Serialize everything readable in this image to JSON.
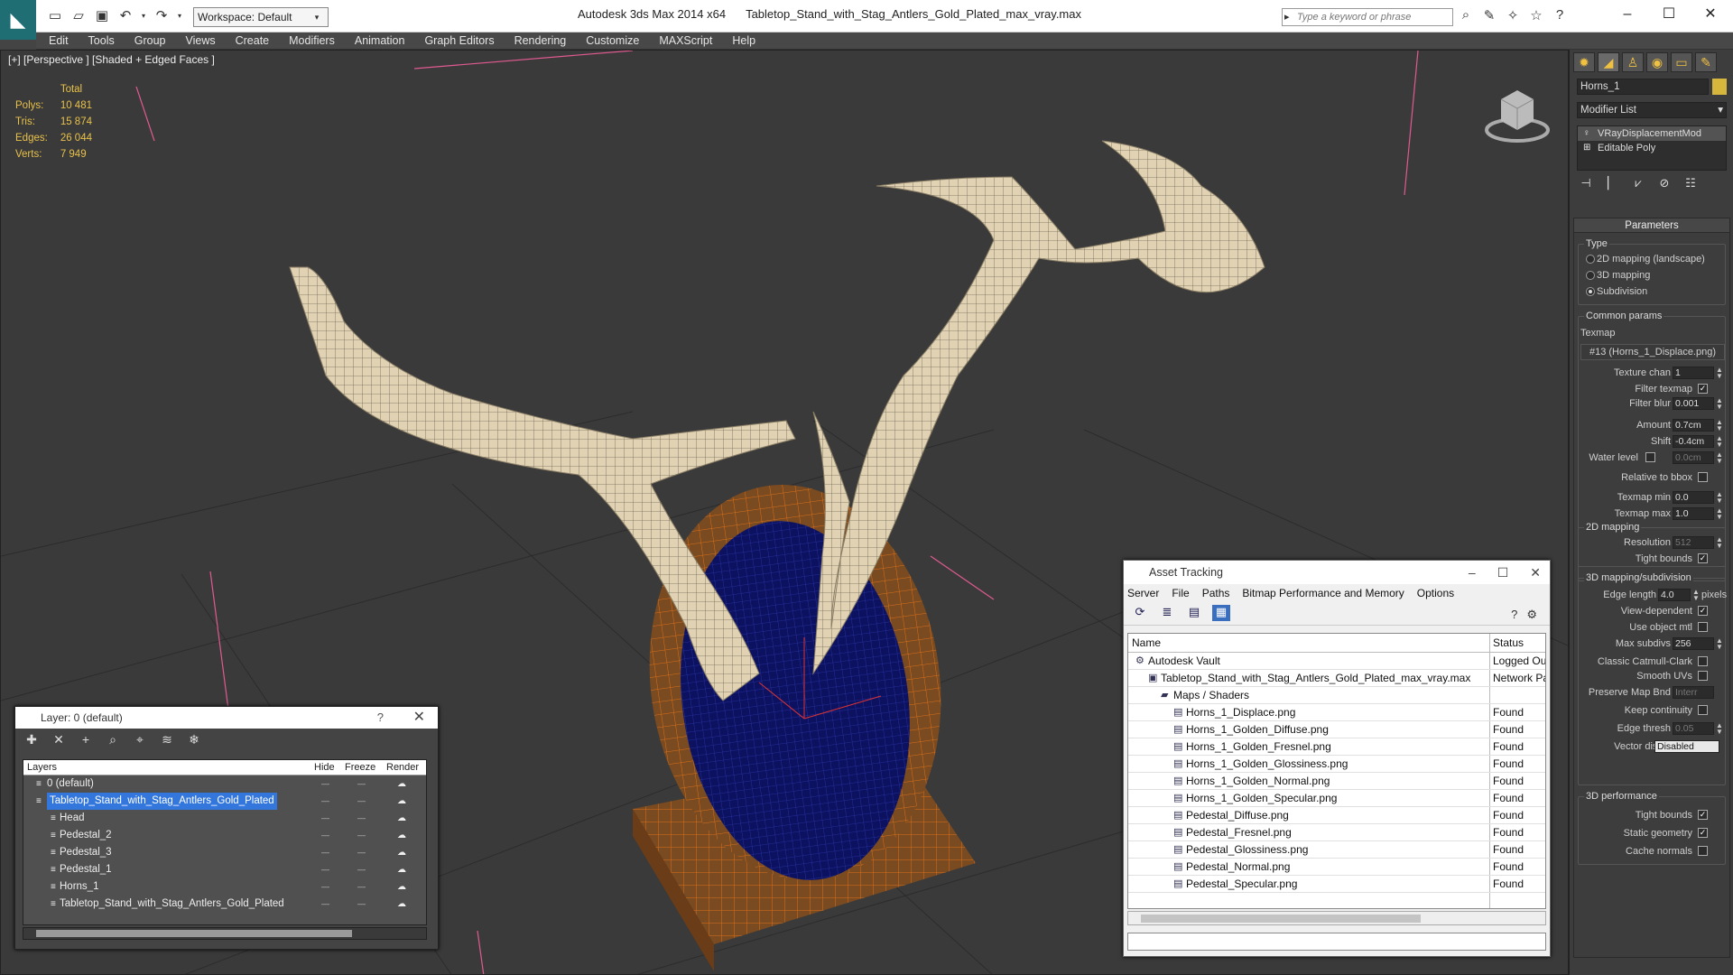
{
  "app": {
    "workspace": "Workspace: Default",
    "title": "Autodesk 3ds Max  2014 x64",
    "file": "Tabletop_Stand_with_Stag_Antlers_Gold_Plated_max_vray.max",
    "search_placeholder": "Type a keyword or phrase"
  },
  "menu": [
    "Edit",
    "Tools",
    "Group",
    "Views",
    "Create",
    "Modifiers",
    "Animation",
    "Graph Editors",
    "Rendering",
    "Customize",
    "MAXScript",
    "Help"
  ],
  "viewport": {
    "label": "[+] [Perspective ] [Shaded + Edged Faces ]",
    "stats": {
      "header": "Total",
      "rows": [
        {
          "k": "Polys:",
          "v": "10 481"
        },
        {
          "k": "Tris:",
          "v": "15 874"
        },
        {
          "k": "Edges:",
          "v": "26 044"
        },
        {
          "k": "Verts:",
          "v": "7 949"
        }
      ]
    }
  },
  "cmdpanel": {
    "object_name": "Horns_1",
    "object_color": "#d6b63c",
    "modifier_list": "Modifier List",
    "stack": [
      "VRayDisplacementMod",
      "Editable Poly"
    ],
    "rollout_title": "Parameters",
    "type_group": "Type",
    "type_options": [
      "2D mapping (landscape)",
      "3D mapping",
      "Subdivision"
    ],
    "common_group": "Common params",
    "texmap_label": "Texmap",
    "texmap_value": "#13 (Horns_1_Displace.png)",
    "texture_chan": {
      "label": "Texture chan",
      "value": "1"
    },
    "filter_texmap": "Filter texmap",
    "filter_blur": {
      "label": "Filter blur",
      "value": "0.001"
    },
    "amount": {
      "label": "Amount",
      "value": "0.7cm"
    },
    "shift": {
      "label": "Shift",
      "value": "-0.4cm"
    },
    "water_level": {
      "label": "Water level",
      "value": "0.0cm"
    },
    "relative_bbox": "Relative to bbox",
    "texmap_min": {
      "label": "Texmap min",
      "value": "0.0"
    },
    "texmap_max": {
      "label": "Texmap max",
      "value": "1.0"
    },
    "mapping2d_group": "2D mapping",
    "resolution": {
      "label": "Resolution",
      "value": "512"
    },
    "tight_bounds_2d": "Tight bounds",
    "mapping3d_group": "3D mapping/subdivision",
    "edge_length": {
      "label": "Edge length",
      "value": "4.0",
      "unit": "pixels"
    },
    "view_dependent": "View-dependent",
    "use_object_mtl": "Use object mtl",
    "max_subdivs": {
      "label": "Max subdivs",
      "value": "256"
    },
    "classic_catmull": "Classic Catmull-Clark",
    "smooth_uvs": "Smooth UVs",
    "preserve_map": {
      "label": "Preserve Map Bnd",
      "value": "Interr"
    },
    "keep_continuity": "Keep continuity",
    "edge_thresh": {
      "label": "Edge thresh",
      "value": "0.05"
    },
    "vector_displ": {
      "label": "Vector displ",
      "value": "Disabled"
    },
    "perf_group": "3D performance",
    "tight_bounds": "Tight bounds",
    "static_geometry": "Static geometry",
    "cache_normals": "Cache normals"
  },
  "layer_dialog": {
    "title": "Layer: 0 (default)",
    "help": "?",
    "columns": {
      "name": "Layers",
      "hide": "Hide",
      "freeze": "Freeze",
      "render": "Render"
    },
    "rows": [
      {
        "name": "0 (default)",
        "indent": 1,
        "selected": false
      },
      {
        "name": "Tabletop_Stand_with_Stag_Antlers_Gold_Plated",
        "indent": 1,
        "selected": true
      },
      {
        "name": "Head",
        "indent": 2,
        "selected": false
      },
      {
        "name": "Pedestal_2",
        "indent": 2,
        "selected": false
      },
      {
        "name": "Pedestal_3",
        "indent": 2,
        "selected": false
      },
      {
        "name": "Pedestal_1",
        "indent": 2,
        "selected": false
      },
      {
        "name": "Horns_1",
        "indent": 2,
        "selected": false
      },
      {
        "name": "Tabletop_Stand_with_Stag_Antlers_Gold_Plated",
        "indent": 2,
        "selected": false
      }
    ]
  },
  "asset_dialog": {
    "title": "Asset Tracking",
    "menu": [
      "Server",
      "File",
      "Paths",
      "Bitmap Performance and Memory",
      "Options"
    ],
    "columns": {
      "name": "Name",
      "status": "Status"
    },
    "rows": [
      {
        "name": "Autodesk Vault",
        "status": "Logged Out",
        "indent": 1
      },
      {
        "name": "Tabletop_Stand_with_Stag_Antlers_Gold_Plated_max_vray.max",
        "status": "Network Pa",
        "indent": 2
      },
      {
        "name": "Maps / Shaders",
        "status": "",
        "indent": 3
      },
      {
        "name": "Horns_1_Displace.png",
        "status": "Found",
        "indent": 4
      },
      {
        "name": "Horns_1_Golden_Diffuse.png",
        "status": "Found",
        "indent": 4
      },
      {
        "name": "Horns_1_Golden_Fresnel.png",
        "status": "Found",
        "indent": 4
      },
      {
        "name": "Horns_1_Golden_Glossiness.png",
        "status": "Found",
        "indent": 4
      },
      {
        "name": "Horns_1_Golden_Normal.png",
        "status": "Found",
        "indent": 4
      },
      {
        "name": "Horns_1_Golden_Specular.png",
        "status": "Found",
        "indent": 4
      },
      {
        "name": "Pedestal_Diffuse.png",
        "status": "Found",
        "indent": 4
      },
      {
        "name": "Pedestal_Fresnel.png",
        "status": "Found",
        "indent": 4
      },
      {
        "name": "Pedestal_Glossiness.png",
        "status": "Found",
        "indent": 4
      },
      {
        "name": "Pedestal_Normal.png",
        "status": "Found",
        "indent": 4
      },
      {
        "name": "Pedestal_Specular.png",
        "status": "Found",
        "indent": 4
      }
    ]
  }
}
